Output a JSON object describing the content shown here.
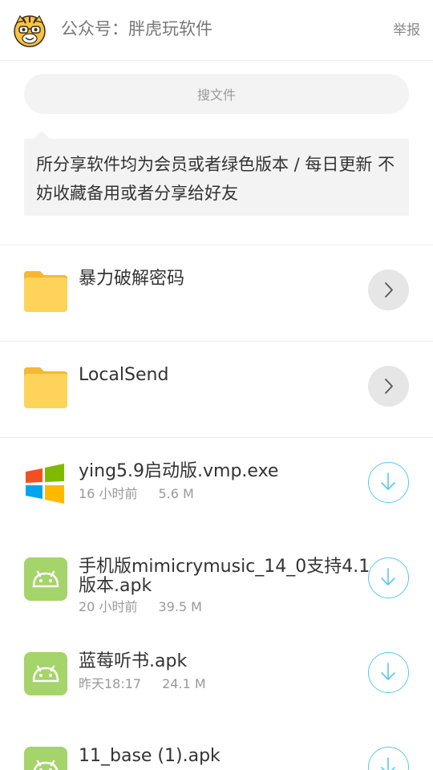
{
  "header": {
    "account_name": "公众号：胖虎玩软件",
    "report_label": "举报",
    "avatar_icon": "tiger-mascot-icon"
  },
  "search": {
    "placeholder": "搜文件"
  },
  "notice": {
    "text": "所分享软件均为会员或者绿色版本 / 每日更新 不妨收藏备用或者分享给好友"
  },
  "items": [
    {
      "type": "folder",
      "name": "暴力破解密码",
      "icon": "folder-icon",
      "action_icon": "chevron-right-icon"
    },
    {
      "type": "folder",
      "name": "LocalSend",
      "icon": "folder-icon",
      "action_icon": "chevron-right-icon"
    },
    {
      "type": "file",
      "name": "ying5.9启动版.vmp.exe",
      "time": "16 小时前",
      "size": "5.6 M",
      "icon": "windows-icon",
      "action_icon": "download-icon"
    },
    {
      "type": "file",
      "name": "手机版mimicrymusic_14_0支持4.1版本.apk",
      "time": "20 小时前",
      "size": "39.5 M",
      "icon": "android-icon",
      "action_icon": "download-icon"
    },
    {
      "type": "file",
      "name": "蓝莓听书.apk",
      "time": "昨天18:17",
      "size": "24.1 M",
      "icon": "android-icon",
      "action_icon": "download-icon"
    },
    {
      "type": "file",
      "name": "11_base (1).apk",
      "time": "",
      "size": "",
      "icon": "android-icon",
      "action_icon": "download-icon"
    }
  ],
  "colors": {
    "folder": "#fdd35a",
    "folder_tab": "#f7b731",
    "android": "#a4d46a",
    "download_accent": "#5ac8ee",
    "windows": [
      "#f25022",
      "#7fba00",
      "#00a4ef",
      "#ffb900"
    ]
  }
}
